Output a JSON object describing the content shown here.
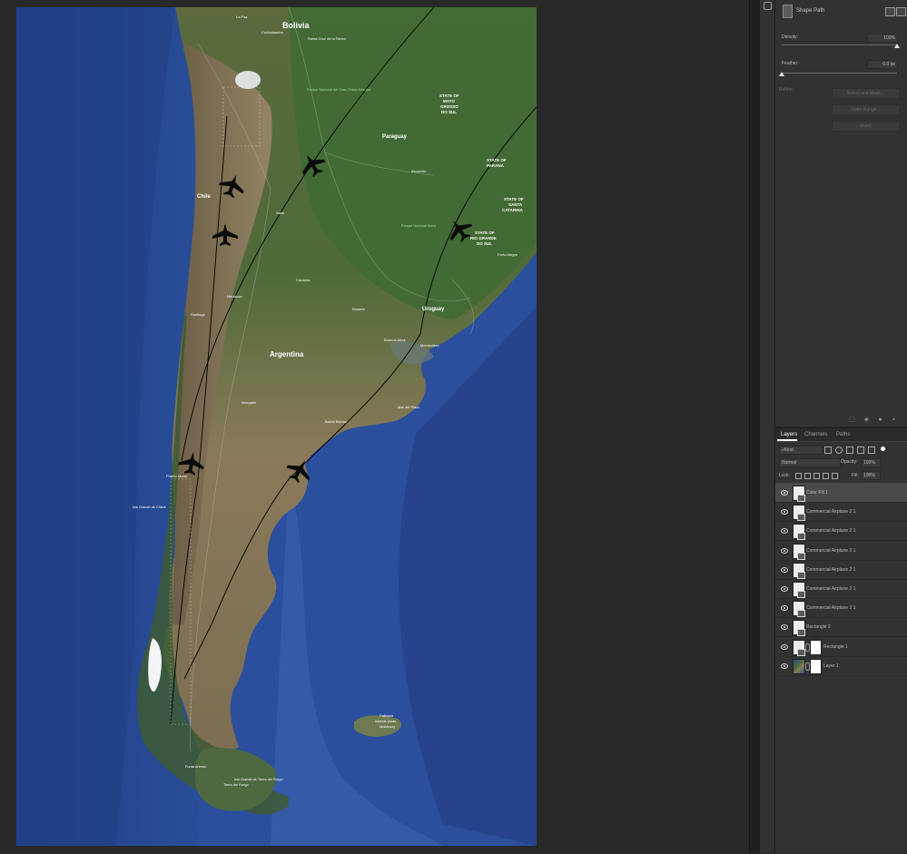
{
  "map": {
    "country_labels": [
      "Bolivia",
      "Paraguay",
      "Argentina",
      "Uruguay",
      "Chile"
    ],
    "state_labels": [
      [
        "STATE OF",
        "MATO",
        "GROSSO",
        "DO SUL"
      ],
      [
        "STATE OF",
        "PARANÁ"
      ],
      [
        "STATE OF",
        "SANTA",
        "CATARINA"
      ],
      [
        "STATE OF",
        "RIO GRANDE",
        "DO SUL"
      ]
    ],
    "city_labels": [
      "La Paz",
      "Cochabamba",
      "Santa Cruz de la Sierra",
      "Asunción",
      "Córdoba",
      "Rosario",
      "Buenos Aires",
      "Montevideo",
      "Porto Alegre",
      "Mar del Plata",
      "Bahía Blanca",
      "Salta",
      "Mendoza",
      "Santiago",
      "Puerto Montt",
      "Neuquén"
    ],
    "park_labels": [
      "Parque Nacional del Gran Chaco Kaa-Iya",
      "Parque Nacional Iberá"
    ],
    "island_labels": [
      "Falkland",
      "Islands (Islas",
      "Malvinas)"
    ],
    "other_labels": [
      "Isla Grande de Chiloé",
      "Tierra del Fuego",
      "Isla Grande de Tierra del Fuego",
      "Punta Arenas"
    ],
    "airplane_count": 6
  },
  "properties_panel": {
    "shape_path_label": "Shape Path",
    "density_label": "Density:",
    "density_value": "100%",
    "density_level": 1.0,
    "feather_label": "Feather:",
    "feather_value": "0.0 px",
    "feather_level": 0.0,
    "refine_label": "Refine:",
    "select_mask_button": "Select and Mask...",
    "color_range_button": "Color Range...",
    "invert_button": "Invert"
  },
  "layers_panel": {
    "tabs": [
      "Layers",
      "Channels",
      "Paths"
    ],
    "active_tab": "Layers",
    "filter_kind": "Kind",
    "blend_mode": "Normal",
    "opacity_label": "Opacity:",
    "opacity_value": "100%",
    "lock_label": "Lock:",
    "fill_label": "Fill:",
    "fill_value": "100%",
    "layers": [
      {
        "name": "Color Fill 1",
        "type": "smart",
        "selected": true
      },
      {
        "name": "Commercial Airplane 2 1",
        "type": "smart"
      },
      {
        "name": "Commercial Airplane 2 1",
        "type": "smart"
      },
      {
        "name": "Commercial Airplane 2 1",
        "type": "smart"
      },
      {
        "name": "Commercial Airplane 2 1",
        "type": "smart"
      },
      {
        "name": "Commercial Airplane 2 1",
        "type": "smart"
      },
      {
        "name": "Commercial Airplane 2 1",
        "type": "smart"
      },
      {
        "name": "Rectangle 2",
        "type": "smart"
      },
      {
        "name": "Rectangle 1",
        "type": "masked"
      },
      {
        "name": "Layer 1",
        "type": "image-masked"
      }
    ]
  },
  "colors": {
    "app_background": "#282828",
    "panel": "#323232",
    "ocean": "#2b4c8e",
    "selected_layer": "#4a4a4a"
  }
}
